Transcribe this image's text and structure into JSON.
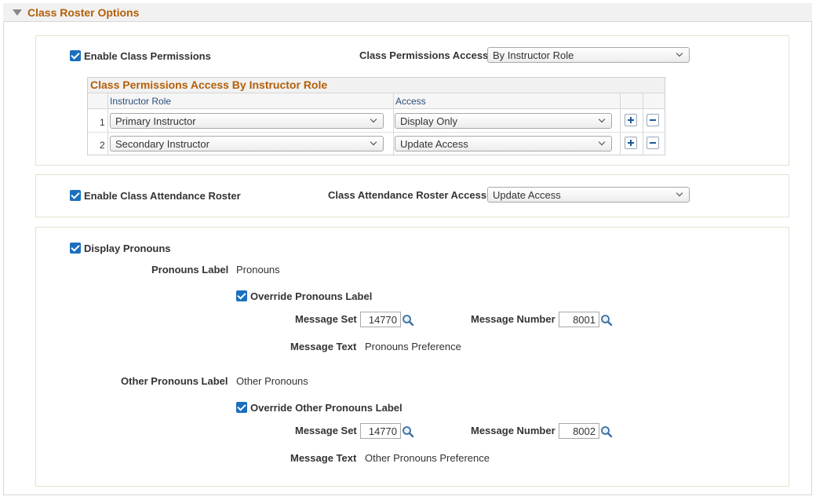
{
  "section_title": "Class Roster Options",
  "permissions": {
    "enable_label": "Enable Class Permissions",
    "access_label": "Class Permissions Access",
    "access_value": "By Instructor Role",
    "grid_title": "Class Permissions Access By Instructor Role",
    "columns": [
      "Instructor Role",
      "Access"
    ],
    "rows": [
      {
        "num": "1",
        "role": "Primary Instructor",
        "access": "Display Only"
      },
      {
        "num": "2",
        "role": "Secondary Instructor",
        "access": "Update Access"
      }
    ]
  },
  "attendance": {
    "enable_label": "Enable Class Attendance Roster",
    "access_label": "Class Attendance Roster Access",
    "access_value": "Update Access"
  },
  "pronouns": {
    "display_label": "Display Pronouns",
    "label_label": "Pronouns Label",
    "label_value": "Pronouns",
    "override_label": "Override Pronouns Label",
    "message_set_label": "Message Set",
    "message_set_value": "14770",
    "message_number_label": "Message Number",
    "message_number_value": "8001",
    "message_text_label": "Message Text",
    "message_text_value": "Pronouns Preference",
    "other_label_label": "Other Pronouns Label",
    "other_label_value": "Other Pronouns",
    "other_override_label": "Override Other Pronouns Label",
    "other_message_set_value": "14770",
    "other_message_number_value": "8002",
    "other_message_text_value": "Other Pronouns Preference"
  }
}
